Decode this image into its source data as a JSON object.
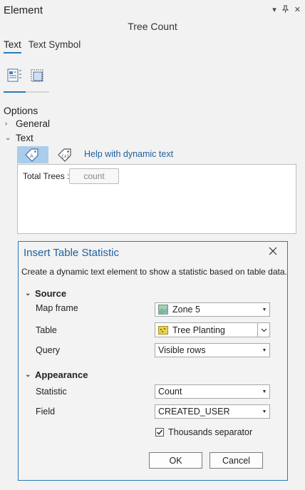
{
  "pane": {
    "title": "Element",
    "element_name": "Tree Count",
    "tabs": [
      {
        "label": "Text",
        "active": true
      },
      {
        "label": "Text Symbol",
        "active": false
      }
    ],
    "options_heading": "Options",
    "tree": {
      "general_label": "General",
      "text_label": "Text"
    },
    "help_link": "Help with dynamic text",
    "text_prefix": "Total Trees :",
    "token_text": "count"
  },
  "dialog": {
    "title": "Insert Table Statistic",
    "description": "Create a dynamic text element to show a statistic based on table data.",
    "source_heading": "Source",
    "appearance_heading": "Appearance",
    "fields": {
      "map_frame": {
        "label": "Map frame",
        "value": "Zone 5",
        "icon": "map-frame-icon"
      },
      "table": {
        "label": "Table",
        "value": "Tree Planting",
        "icon": "table-layer-icon"
      },
      "query": {
        "label": "Query",
        "value": "Visible rows"
      },
      "statistic": {
        "label": "Statistic",
        "value": "Count"
      },
      "field": {
        "label": "Field",
        "value": "CREATED_USER"
      }
    },
    "thousands_separator": {
      "label": "Thousands separator",
      "checked": true
    },
    "ok_label": "OK",
    "cancel_label": "Cancel"
  },
  "colors": {
    "accent": "#2a7ab8",
    "link": "#1f5f9e",
    "pane_bg": "#f2f2f2",
    "selected_button_bg": "#a9cdea"
  }
}
